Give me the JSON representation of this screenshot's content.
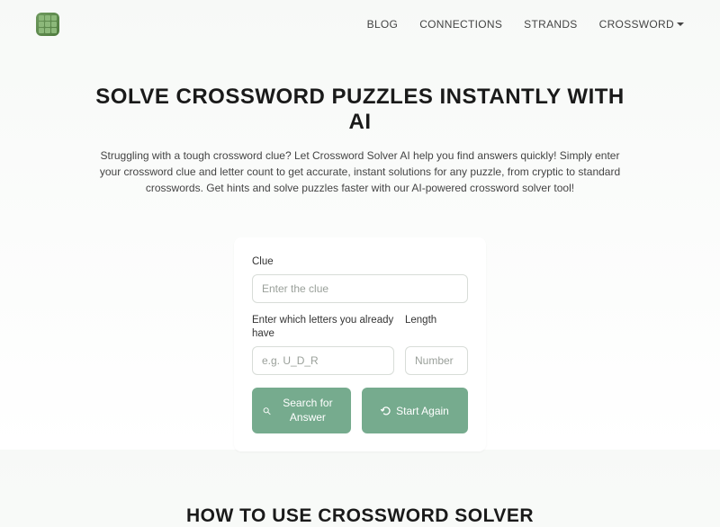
{
  "nav": {
    "links": [
      {
        "label": "BLOG"
      },
      {
        "label": "CONNECTIONS"
      },
      {
        "label": "STRANDS"
      },
      {
        "label": "CROSSWORD",
        "has_dropdown": true
      }
    ]
  },
  "hero": {
    "title": "SOLVE CROSSWORD PUZZLES INSTANTLY WITH AI",
    "description": "Struggling with a tough crossword clue? Let Crossword Solver AI help you find answers quickly! Simply enter your crossword clue and letter count to get accurate, instant solutions for any puzzle, from cryptic to standard crosswords. Get hints and solve puzzles faster with our AI-powered crossword solver tool!"
  },
  "form": {
    "clue_label": "Clue",
    "clue_placeholder": "Enter the clue",
    "letters_label": "Enter which letters you already have",
    "letters_placeholder": "e.g. U_D_R",
    "length_label": "Length",
    "length_placeholder": "Number",
    "search_button": "Search for Answer",
    "reset_button": "Start Again"
  },
  "section2": {
    "title": "HOW TO USE CROSSWORD SOLVER"
  },
  "colors": {
    "accent": "#76ab8e",
    "logo_dark": "#4e7a3d",
    "logo_light": "#8cb87a"
  }
}
